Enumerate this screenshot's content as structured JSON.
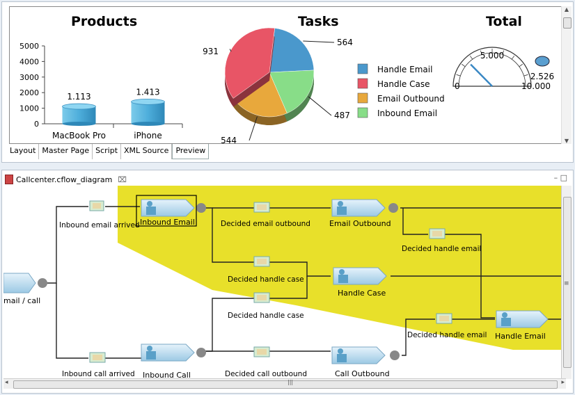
{
  "report": {
    "products_title": "Products",
    "tasks_title": "Tasks",
    "total_title": "Total"
  },
  "tabs": [
    "Layout",
    "Master Page",
    "Script",
    "XML Source",
    "Preview"
  ],
  "editor": {
    "tab_label": "Callcenter.cflow_diagram",
    "close": "⌧",
    "controls": "–  □"
  },
  "chart_data": [
    {
      "type": "bar",
      "title": "Products",
      "categories": [
        "MacBook Pro",
        "iPhone"
      ],
      "values": [
        1113,
        1413
      ],
      "value_labels": [
        "1.113",
        "1.413"
      ],
      "ylim": [
        0,
        5000
      ],
      "yticks": [
        "0",
        "1000",
        "2000",
        "3000",
        "4000",
        "5000"
      ],
      "color": "#5ab4dc"
    },
    {
      "type": "pie",
      "title": "Tasks",
      "slices": [
        {
          "label": "Handle Email",
          "value": 564,
          "color": "#4a98cc"
        },
        {
          "label": "Inbound Email",
          "value": 487,
          "color": "#88dd88"
        },
        {
          "label": "Email Outbound",
          "value": 544,
          "color": "#e8a83c"
        },
        {
          "label": "Handle Case",
          "value": 931,
          "color": "#e85566"
        }
      ],
      "legend": [
        "Handle Email",
        "Handle Case",
        "Email Outbound",
        "Inbound Email"
      ],
      "legend_colors": [
        "#4a98cc",
        "#e85566",
        "#e8a83c",
        "#88dd88"
      ]
    },
    {
      "type": "gauge",
      "title": "Total",
      "value": 2526,
      "value_label": "2.526",
      "min_label": "0",
      "mid_label": "5.000",
      "max_label": "10.000",
      "range": [
        0,
        10000
      ]
    }
  ],
  "diagram": {
    "nodes": {
      "email_call": "mail / call",
      "inbound_email_arrived": "Inbound email arrived",
      "inbound_email": "Inbound Email",
      "decided_email_outbound": "Decided email outbound",
      "email_outbound": "Email Outbound",
      "decided_handle_email_1": "Decided handle email",
      "decided_handle_case_1": "Decided handle case",
      "handle_case": "Handle Case",
      "decided_handle_case_2": "Decided handle case",
      "decided_handle_email_2": "Decided handle email",
      "handle_email": "Handle Email",
      "inbound_call_arrived": "Inbound call arrived",
      "inbound_call": "Inbound Call",
      "decided_call_outbound": "Decided call outbound",
      "call_outbound": "Call Outbound"
    },
    "highlight_color": "#e8e02a"
  }
}
